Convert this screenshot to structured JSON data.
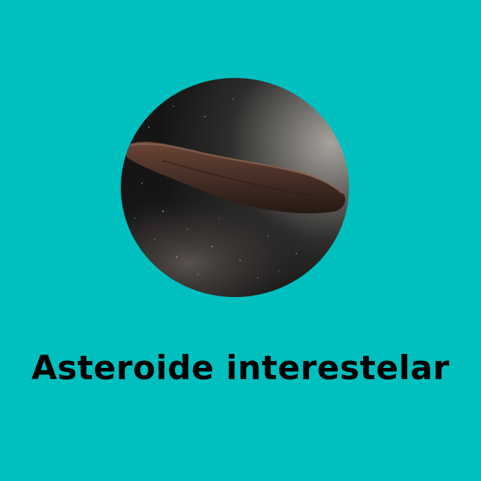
{
  "theme": {
    "background_color": "#00BFBF",
    "caption_color": "#000000"
  },
  "illustration": {
    "subject": "elongated-interstellar-asteroid",
    "sky_color": "#171716",
    "glow_color": "#8c8a85",
    "rock_color": "#4a3128",
    "milky_way_color": "#5a5350"
  },
  "caption": {
    "text": "Asteroide interestelar"
  }
}
